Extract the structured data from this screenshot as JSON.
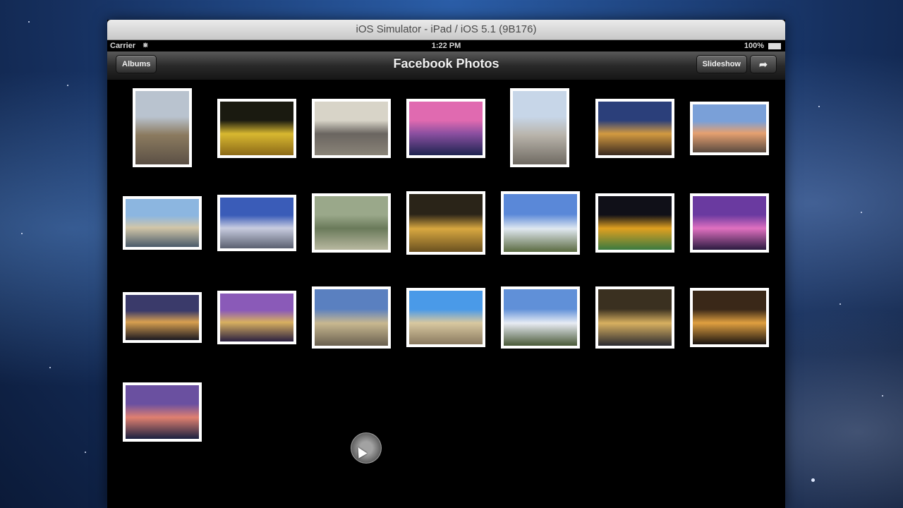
{
  "window": {
    "title": "iOS Simulator - iPad / iOS 5.1 (9B176)"
  },
  "status_bar": {
    "carrier": "Carrier",
    "time": "1:22 PM",
    "battery": "100%"
  },
  "nav_bar": {
    "title": "Facebook Photos",
    "albums_label": "Albums",
    "slideshow_label": "Slideshow",
    "share_icon": "share-icon"
  },
  "colors": {
    "desktop": "#16305f",
    "screen": "#000000",
    "thumb_border": "#ffffff"
  },
  "photos": [
    {
      "subject": "trampoline",
      "colors": [
        "#b9c3cf",
        "#8b7a5f",
        "#5b5045"
      ]
    },
    {
      "subject": "lit trees",
      "colors": [
        "#1a1a10",
        "#d8b830",
        "#8c6a18"
      ]
    },
    {
      "subject": "seine bridge",
      "colors": [
        "#d8d4c8",
        "#6a6560",
        "#8a8478"
      ]
    },
    {
      "subject": "pink sunset river",
      "colors": [
        "#e06ab0",
        "#8a4fa0",
        "#1e2450"
      ]
    },
    {
      "subject": "notre dame facade",
      "colors": [
        "#c7d6e8",
        "#b9b4ab",
        "#6f6a62"
      ]
    },
    {
      "subject": "arc de triomphe dusk",
      "colors": [
        "#2b3f7a",
        "#d39a40",
        "#3a2a20"
      ]
    },
    {
      "subject": "gargoyle skyline",
      "colors": [
        "#7aa0d8",
        "#e6a070",
        "#5a4a40"
      ]
    },
    {
      "subject": "alexandre bridge",
      "colors": [
        "#8cb6e0",
        "#d2c6a8",
        "#4a5a6a"
      ]
    },
    {
      "subject": "eiffel fountain",
      "colors": [
        "#3a5cb8",
        "#c8cce0",
        "#5a6070"
      ]
    },
    {
      "subject": "aerial city",
      "colors": [
        "#9aa88a",
        "#6a7a5a",
        "#b8b8a0"
      ]
    },
    {
      "subject": "eiffel night gold",
      "colors": [
        "#2a2418",
        "#d8a840",
        "#6a5020"
      ]
    },
    {
      "subject": "notre dame side",
      "colors": [
        "#5a88d8",
        "#e0e8f0",
        "#5a6a40"
      ]
    },
    {
      "subject": "eiffel lights",
      "colors": [
        "#101018",
        "#e0a020",
        "#3a7a40"
      ]
    },
    {
      "subject": "eiffel purple",
      "colors": [
        "#6a3aa0",
        "#e070c0",
        "#2a1a40"
      ]
    },
    {
      "subject": "city night aerial",
      "colors": [
        "#3a3a6a",
        "#d8a050",
        "#1a1820"
      ]
    },
    {
      "subject": "arc purple",
      "colors": [
        "#8a5ab8",
        "#d8b060",
        "#2a2040"
      ]
    },
    {
      "subject": "louvre cloudy",
      "colors": [
        "#5a80c0",
        "#c8b890",
        "#6a6050"
      ]
    },
    {
      "subject": "obelisk",
      "colors": [
        "#4a9ae8",
        "#d8c8a0",
        "#8a7a60"
      ]
    },
    {
      "subject": "notre dame clouds",
      "colors": [
        "#6090d8",
        "#e8ecf4",
        "#4a5a38"
      ]
    },
    {
      "subject": "eiffel dusk",
      "colors": [
        "#3a3020",
        "#d8b060",
        "#2a2a30"
      ]
    },
    {
      "subject": "notre dame night",
      "colors": [
        "#3a2818",
        "#e0a040",
        "#1a1410"
      ]
    },
    {
      "subject": "reflection sunset",
      "colors": [
        "#6a50a0",
        "#e08070",
        "#1a2040"
      ]
    }
  ]
}
